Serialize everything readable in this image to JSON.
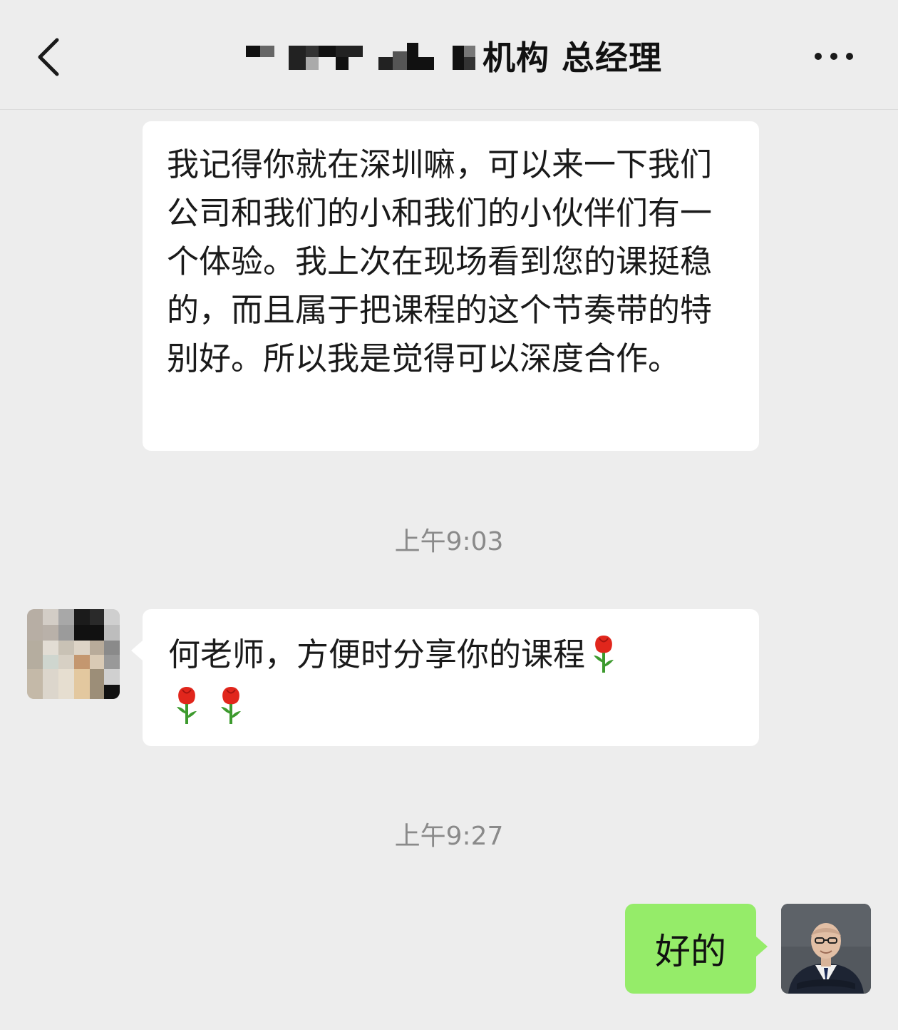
{
  "header": {
    "title": "机构 总经理",
    "back_icon": "chevron-left-icon",
    "more_icon": "ellipsis-icon"
  },
  "messages": [
    {
      "side": "left",
      "text": "我记得你就在深圳嘛，可以来一下我们公司和我们的小和我们的小伙伴们有一个体验。我上次在现场看到您的课挺稳的，而且属于把课程的这个节奏带的特别好。所以我是觉得可以深度合作。"
    },
    {
      "side": "left",
      "text": "何老师，方便时分享你的课程",
      "emoji": "rose-icon",
      "emoji_count": 3
    },
    {
      "side": "right",
      "text": "好的"
    }
  ],
  "timestamps": [
    "上午9:03",
    "上午9:27"
  ],
  "colors": {
    "background": "#ededed",
    "bubble_incoming": "#ffffff",
    "bubble_outgoing": "#95ec69",
    "timestamp": "#8a8a8a"
  }
}
